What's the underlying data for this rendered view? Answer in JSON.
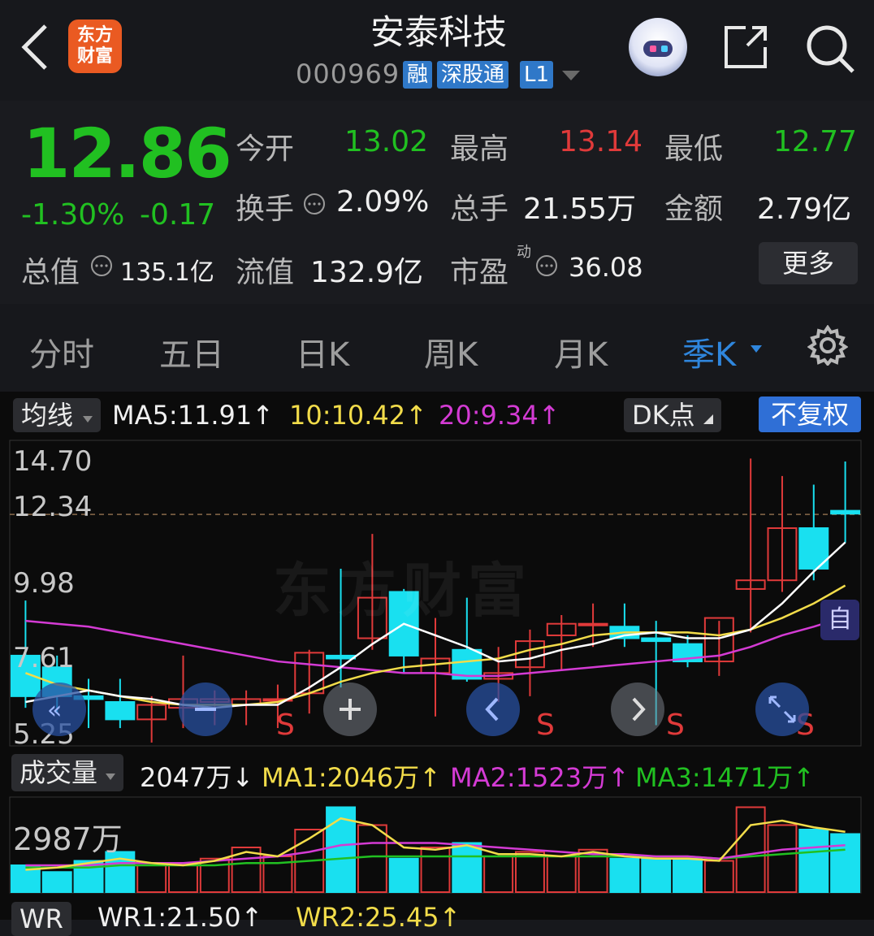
{
  "header": {
    "logo_line1": "东方",
    "logo_line2": "财富",
    "title": "安泰科技",
    "code": "000969",
    "tags": [
      "融",
      "深股通",
      "L1"
    ]
  },
  "quote": {
    "price": "12.86",
    "pct": "-1.30%",
    "change": "-0.17",
    "open_label": "今开",
    "open": "13.02",
    "high_label": "最高",
    "high": "13.14",
    "low_label": "最低",
    "low": "12.77",
    "turnover_label": "换手",
    "turnover": "2.09%",
    "volume_label": "总手",
    "volume": "21.55万",
    "amount_label": "金额",
    "amount": "2.79亿",
    "mktcap_label": "总值",
    "mktcap": "135.1亿",
    "float_label": "流值",
    "float": "132.9亿",
    "pe_label": "市盈",
    "pe_sup": "动",
    "pe": "36.08",
    "more": "更多"
  },
  "tabs": [
    "分时",
    "五日",
    "日K",
    "周K",
    "月K",
    "季K"
  ],
  "active_tab": "季K",
  "ma_bar": {
    "selector": "均线",
    "ma5": "MA5:11.91",
    "ma10": "10:10.42",
    "ma20": "20:9.34",
    "dk": "DK点",
    "fq": "不复权"
  },
  "price_axis": [
    "14.70",
    "12.34",
    "9.98",
    "7.61",
    "5.25"
  ],
  "signals": [
    "S",
    "S",
    "S",
    "S"
  ],
  "auto_label": "自",
  "watermark": "东方财富",
  "vol_bar": {
    "selector": "成交量",
    "vol": "2047万",
    "ma1": "MA1:2046万",
    "ma2": "MA2:1523万",
    "ma3": "MA3:1471万",
    "axis_top": "2987万"
  },
  "wr_bar": {
    "selector": "WR",
    "wr1": "WR1:21.50",
    "wr2": "WR2:25.45"
  },
  "colors": {
    "up": "#e03a3a",
    "down": "#19e0f0",
    "ma5": "#ffffff",
    "ma10": "#f2dc4a",
    "ma20": "#d43bd4",
    "green": "#21c021",
    "blue": "#2f86dd"
  },
  "chart_data": {
    "type": "candlestick",
    "ylim": [
      5.25,
      14.7
    ],
    "candles": [
      {
        "o": 8.0,
        "h": 9.9,
        "l": 6.2,
        "c": 6.6
      },
      {
        "o": 7.6,
        "h": 8.0,
        "l": 6.0,
        "c": 6.6
      },
      {
        "o": 6.6,
        "h": 7.2,
        "l": 5.5,
        "c": 6.5
      },
      {
        "o": 6.4,
        "h": 7.2,
        "l": 5.5,
        "c": 5.8
      },
      {
        "o": 5.8,
        "h": 6.6,
        "l": 5.0,
        "c": 6.3
      },
      {
        "o": 6.2,
        "h": 8.0,
        "l": 5.5,
        "c": 6.5
      },
      {
        "o": 6.4,
        "h": 6.8,
        "l": 5.6,
        "c": 6.5
      },
      {
        "o": 6.3,
        "h": 6.8,
        "l": 5.6,
        "c": 6.5
      },
      {
        "o": 6.5,
        "h": 7.0,
        "l": 5.5,
        "c": 6.5
      },
      {
        "o": 6.7,
        "h": 8.2,
        "l": 6.0,
        "c": 8.1
      },
      {
        "o": 8.0,
        "h": 11.0,
        "l": 6.9,
        "c": 7.9
      },
      {
        "o": 8.6,
        "h": 12.2,
        "l": 8.2,
        "c": 10.0
      },
      {
        "o": 10.2,
        "h": 10.3,
        "l": 7.4,
        "c": 8.0
      },
      {
        "o": 7.4,
        "h": 9.3,
        "l": 5.9,
        "c": 7.9
      },
      {
        "o": 8.2,
        "h": 10.0,
        "l": 7.1,
        "c": 7.2
      },
      {
        "o": 7.2,
        "h": 8.3,
        "l": 6.4,
        "c": 7.4
      },
      {
        "o": 7.6,
        "h": 8.9,
        "l": 6.6,
        "c": 8.5
      },
      {
        "o": 8.7,
        "h": 9.4,
        "l": 7.5,
        "c": 9.1
      },
      {
        "o": 9.1,
        "h": 9.8,
        "l": 8.3,
        "c": 9.1
      },
      {
        "o": 9.0,
        "h": 9.8,
        "l": 8.3,
        "c": 8.6
      },
      {
        "o": 8.6,
        "h": 9.2,
        "l": 5.6,
        "c": 8.5
      },
      {
        "o": 8.4,
        "h": 8.7,
        "l": 7.6,
        "c": 7.8
      },
      {
        "o": 7.8,
        "h": 9.2,
        "l": 7.3,
        "c": 9.3
      },
      {
        "o": 10.3,
        "h": 14.8,
        "l": 8.8,
        "c": 10.6
      },
      {
        "o": 10.6,
        "h": 14.2,
        "l": 10.2,
        "c": 12.4
      },
      {
        "o": 12.4,
        "h": 13.9,
        "l": 10.6,
        "c": 11.0
      },
      {
        "o": 13.0,
        "h": 14.7,
        "l": 11.9,
        "c": 12.9
      }
    ],
    "volume": [
      12,
      9,
      14,
      18,
      12,
      12,
      15,
      20,
      16,
      28,
      38,
      30,
      15,
      20,
      22,
      16,
      18,
      16,
      19,
      15,
      15,
      15,
      14,
      38,
      30,
      28,
      26
    ],
    "ma5": [
      6.4,
      6.6,
      6.8,
      6.6,
      6.5,
      6.3,
      6.2,
      6.3,
      6.3,
      6.9,
      7.6,
      8.4,
      9.1,
      8.7,
      8.3,
      7.8,
      7.9,
      8.2,
      8.4,
      8.7,
      8.8,
      8.6,
      8.6,
      8.9,
      9.8,
      10.9,
      11.91
    ],
    "ma10": [
      7.4,
      7.0,
      6.8,
      6.6,
      6.4,
      6.3,
      6.3,
      6.3,
      6.4,
      6.7,
      7.1,
      7.4,
      7.6,
      7.7,
      7.8,
      7.9,
      8.2,
      8.4,
      8.7,
      8.8,
      8.8,
      8.8,
      8.7,
      8.9,
      9.3,
      9.8,
      10.42
    ],
    "ma20": [
      9.2,
      9.1,
      9.0,
      8.8,
      8.6,
      8.4,
      8.2,
      8.0,
      7.8,
      7.7,
      7.6,
      7.5,
      7.4,
      7.4,
      7.3,
      7.3,
      7.4,
      7.5,
      7.6,
      7.7,
      7.8,
      7.9,
      8.0,
      8.3,
      8.7,
      9.0,
      9.34
    ],
    "vol_ma": {
      "ma1": [
        10,
        11,
        13,
        15,
        13,
        12,
        14,
        18,
        16,
        24,
        33,
        30,
        20,
        19,
        21,
        17,
        17,
        16,
        18,
        16,
        15,
        15,
        14,
        30,
        32,
        29,
        27
      ],
      "ma2": [
        12,
        12,
        12,
        13,
        13,
        13,
        14,
        15,
        16,
        18,
        21,
        22,
        22,
        22,
        21,
        20,
        19,
        18,
        17,
        17,
        16,
        16,
        15,
        17,
        19,
        20,
        21
      ],
      "ma3": [
        11,
        11,
        11,
        12,
        12,
        12,
        12,
        13,
        13,
        14,
        15,
        16,
        16,
        16,
        16,
        16,
        16,
        16,
        16,
        16,
        16,
        16,
        15,
        16,
        17,
        18,
        19
      ]
    },
    "vol_max": 2987
  }
}
